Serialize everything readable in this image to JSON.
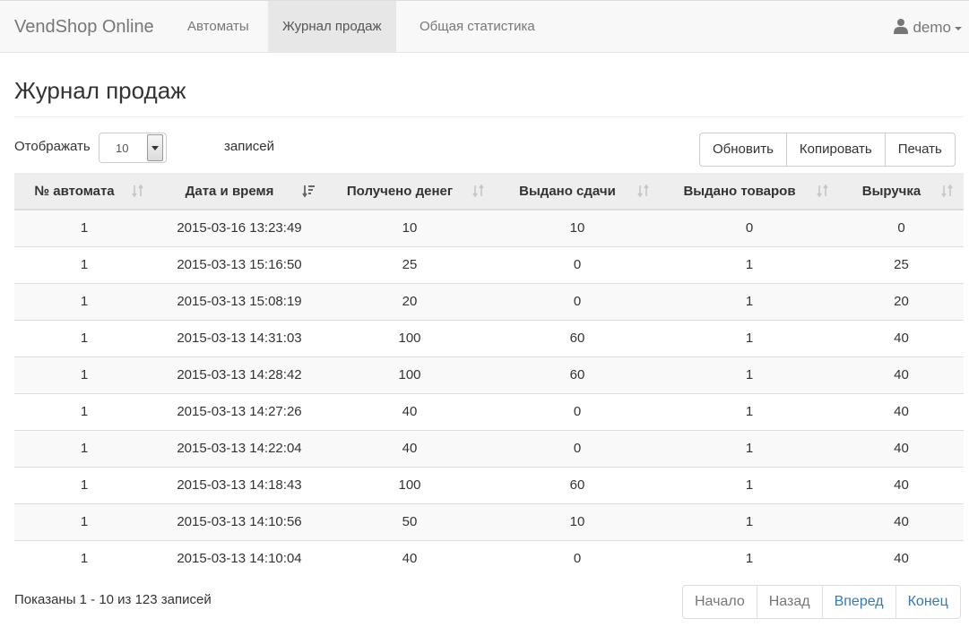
{
  "navbar": {
    "brand": "VendShop Online",
    "items": [
      {
        "label": "Автоматы"
      },
      {
        "label": "Журнал продаж"
      },
      {
        "label": "Общая статистика"
      }
    ],
    "user": "demo"
  },
  "page": {
    "title": "Журнал продаж"
  },
  "length": {
    "before": "Отображать",
    "value": "10",
    "after": "записей"
  },
  "buttons": {
    "refresh": "Обновить",
    "copy": "Копировать",
    "print": "Печать"
  },
  "table": {
    "headers": [
      "№ автомата",
      "Дата и время",
      "Получено денег",
      "Выдано сдачи",
      "Выдано товаров",
      "Выручка"
    ],
    "sorted_column": "Дата и время",
    "rows": [
      [
        "1",
        "2015-03-16 13:23:49",
        "10",
        "10",
        "0",
        "0"
      ],
      [
        "1",
        "2015-03-13 15:16:50",
        "25",
        "0",
        "1",
        "25"
      ],
      [
        "1",
        "2015-03-13 15:08:19",
        "20",
        "0",
        "1",
        "20"
      ],
      [
        "1",
        "2015-03-13 14:31:03",
        "100",
        "60",
        "1",
        "40"
      ],
      [
        "1",
        "2015-03-13 14:28:42",
        "100",
        "60",
        "1",
        "40"
      ],
      [
        "1",
        "2015-03-13 14:27:26",
        "40",
        "0",
        "1",
        "40"
      ],
      [
        "1",
        "2015-03-13 14:22:04",
        "40",
        "0",
        "1",
        "40"
      ],
      [
        "1",
        "2015-03-13 14:18:43",
        "100",
        "60",
        "1",
        "40"
      ],
      [
        "1",
        "2015-03-13 14:10:56",
        "50",
        "10",
        "1",
        "40"
      ],
      [
        "1",
        "2015-03-13 14:10:04",
        "40",
        "0",
        "1",
        "40"
      ]
    ]
  },
  "footer": {
    "info": "Показаны 1 - 10 из 123 записей",
    "pagination": {
      "first": "Начало",
      "prev": "Назад",
      "next": "Вперед",
      "last": "Конец"
    }
  }
}
